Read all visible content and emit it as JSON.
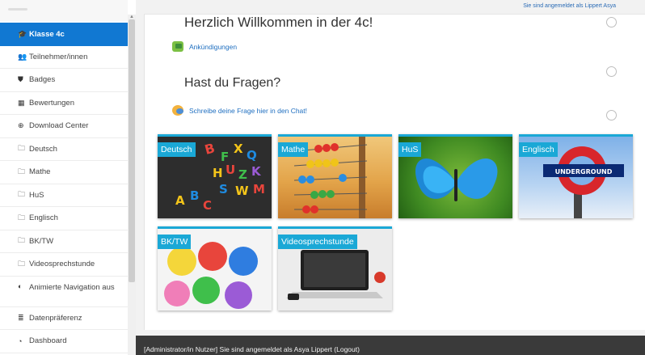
{
  "top_notice": "Sie sind angemeldet als Lippert Asya",
  "sidebar": {
    "items": [
      {
        "icon": "graduation-cap-icon",
        "glyph": "🎓",
        "label": "Klasse 4c"
      },
      {
        "icon": "users-icon",
        "glyph": "👥",
        "label": "Teilnehmer/innen"
      },
      {
        "icon": "shield-icon",
        "glyph": "⛊",
        "label": "Badges"
      },
      {
        "icon": "table-icon",
        "glyph": "▦",
        "label": "Bewertungen"
      },
      {
        "icon": "download-icon",
        "glyph": "⊕",
        "label": "Download Center"
      },
      {
        "icon": "folder-icon",
        "glyph": "🗀",
        "label": "Deutsch"
      },
      {
        "icon": "folder-icon",
        "glyph": "🗀",
        "label": "Mathe"
      },
      {
        "icon": "folder-icon",
        "glyph": "🗀",
        "label": "HuS"
      },
      {
        "icon": "folder-icon",
        "glyph": "🗀",
        "label": "Englisch"
      },
      {
        "icon": "folder-icon",
        "glyph": "🗀",
        "label": "BK/TW"
      },
      {
        "icon": "folder-icon",
        "glyph": "🗀",
        "label": "Videosprechstunde"
      },
      {
        "icon": "toggle-icon",
        "glyph": "◐",
        "label": "Animierte Navigation aus"
      },
      {
        "icon": "database-icon",
        "glyph": "≣",
        "label": "Datenpräferenz"
      },
      {
        "icon": "dashboard-icon",
        "glyph": "◔",
        "label": "Dashboard"
      }
    ]
  },
  "main": {
    "welcome_heading": "Herzlich Willkommen in der 4c!",
    "announcements_link": "Ankündigungen",
    "questions_heading": "Hast du Fragen?",
    "chat_link": "Schreibe deine Frage hier in den Chat!",
    "tiles": [
      {
        "label": "Deutsch"
      },
      {
        "label": "Mathe"
      },
      {
        "label": "HuS"
      },
      {
        "label": "Englisch",
        "sign_text": "UNDERGROUND"
      },
      {
        "label": "BK/TW"
      },
      {
        "label": "Videosprechstunde"
      }
    ]
  },
  "footer": {
    "text": "[Administrator/in Nutzer] Sie sind angemeldet als Asya Lippert (Logout)"
  },
  "colors": {
    "accent": "#1178d2",
    "tile_label": "#1aa8d6",
    "footer_bg": "#3a3a3a"
  }
}
